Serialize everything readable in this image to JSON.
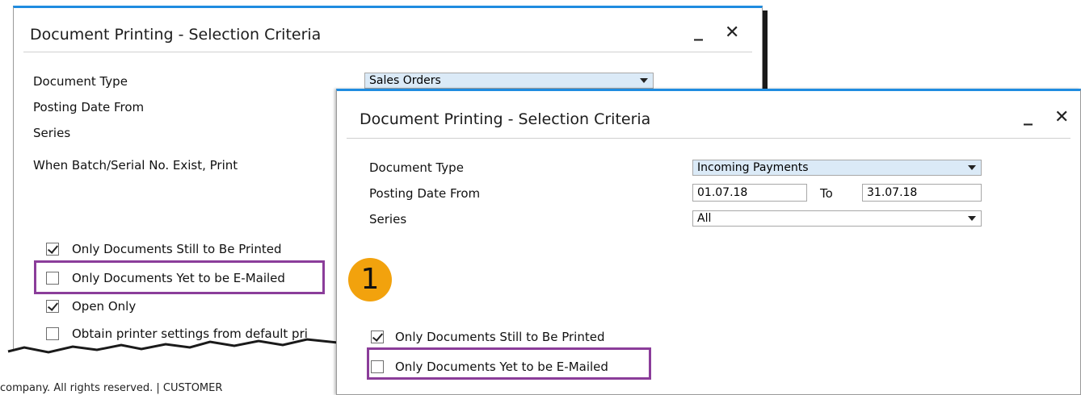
{
  "dialogs": {
    "back": {
      "title": "Document Printing - Selection Criteria",
      "document_type_label": "Document Type",
      "document_type_value": "Sales Orders",
      "posting_date_from_label": "Posting Date From",
      "series_label": "Series",
      "batch_serial_label": "When Batch/Serial No. Exist, Print",
      "only_to_print_label": "Only Documents Still to Be Printed",
      "only_to_email_label": "Only Documents Yet to be E-Mailed",
      "open_only_label": "Open Only",
      "printer_settings_label": "Obtain printer settings from default pri"
    },
    "front": {
      "title": "Document Printing - Selection Criteria",
      "document_type_label": "Document Type",
      "document_type_value": "Incoming Payments",
      "posting_date_from_label": "Posting Date From",
      "date_from_value": "01.07.18",
      "to_label": "To",
      "date_to_value": "31.07.18",
      "series_label": "Series",
      "series_value": "All",
      "only_to_print_label": "Only Documents Still to Be Printed",
      "only_to_email_label": "Only Documents Yet to be E-Mailed"
    }
  },
  "window_controls": {
    "minimize": "_",
    "close": "✕"
  },
  "callout_badge": "1",
  "footer_text": "company. All rights reserved.  |  CUSTOMER",
  "colors": {
    "title_bar_accent": "#1f8ce0",
    "highlight": "#8b3d9a",
    "badge": "#f2a20d",
    "combo_fill": "#dbeaf7"
  },
  "checkbox_states": {
    "back_only_to_print": true,
    "back_only_to_email": false,
    "back_open_only": true,
    "back_printer_settings": false,
    "front_only_to_print": true,
    "front_only_to_email": false
  }
}
